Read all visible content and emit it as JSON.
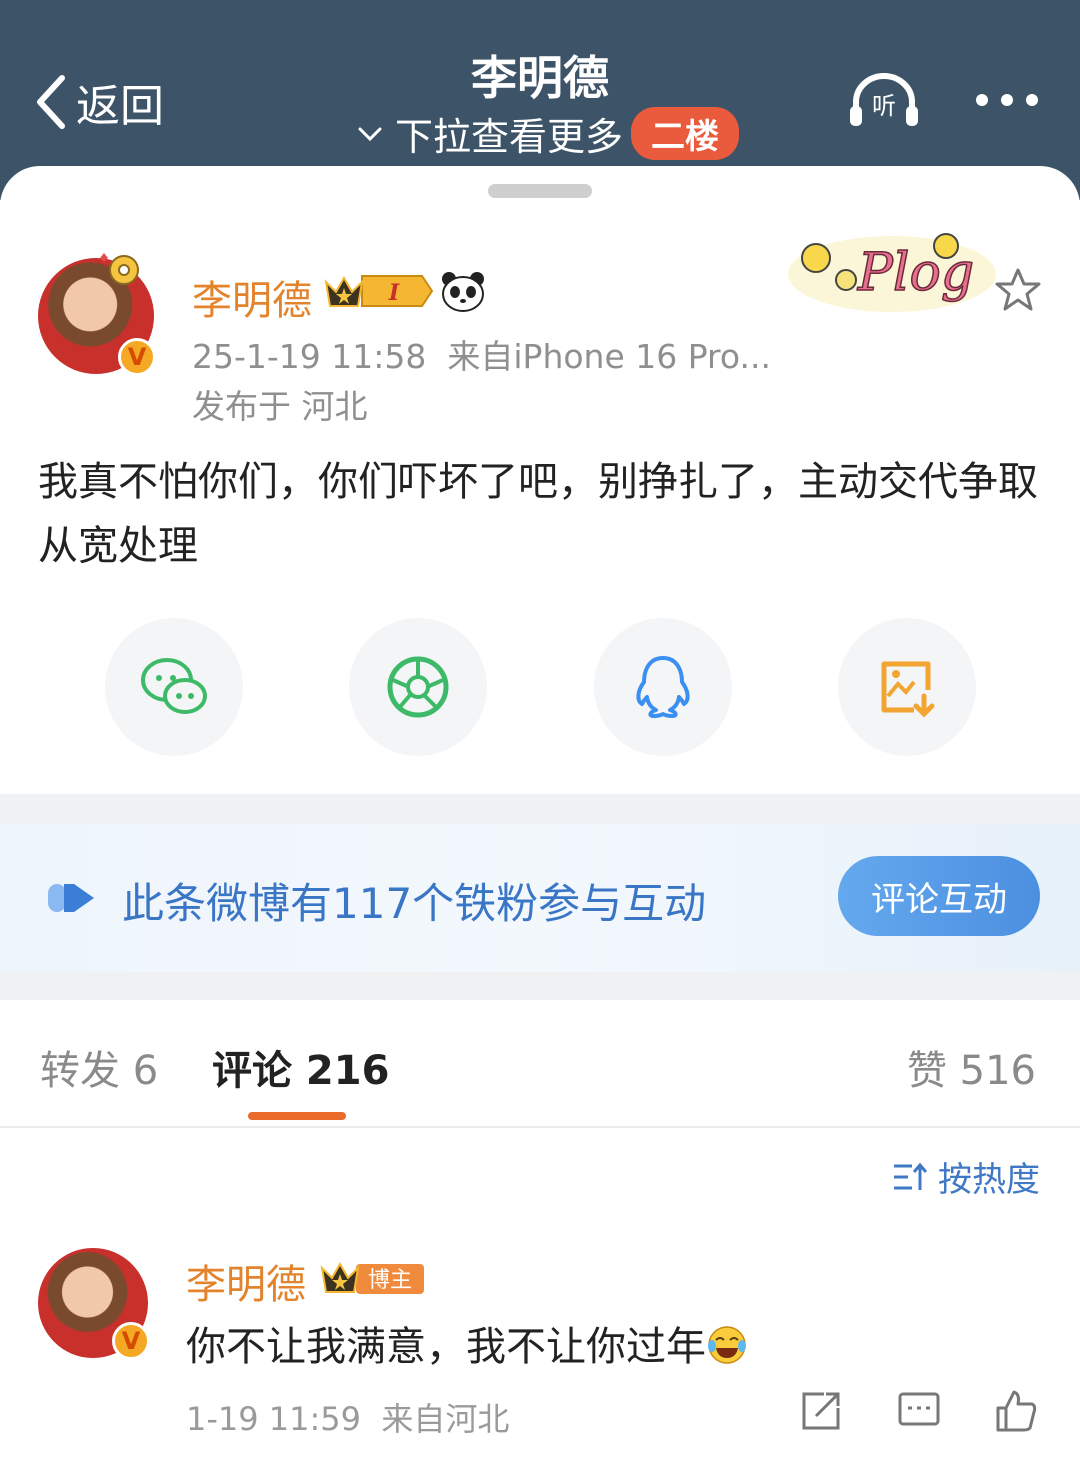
{
  "header": {
    "back_label": "返回",
    "title": "李明德",
    "subtitle": "下拉查看更多",
    "floor_badge": "二楼"
  },
  "post": {
    "author": "李明德",
    "badge_level": "I",
    "timestamp": "25-1-19 11:58",
    "source": "来自iPhone 16 Pro...",
    "location": "发布于 河北",
    "text": "我真不怕你们，你们吓坏了吧，别挣扎了，主动交代争取从宽处理",
    "sticker": "Plog"
  },
  "share": {
    "items": [
      "wechat-icon",
      "moments-icon",
      "qq-icon",
      "save-image-icon"
    ]
  },
  "fans_bar": {
    "text": "此条微博有117个铁粉参与互动",
    "button": "评论互动"
  },
  "tabs": {
    "repost": "转发 6",
    "comments": "评论 216",
    "likes": "赞 516"
  },
  "sort": {
    "label": "按热度"
  },
  "comment": {
    "author": "李明德",
    "badge": "博主",
    "text": "你不让我满意，我不让你过年",
    "emoji": "laughing-tears-icon",
    "time": "1-19 11:59",
    "source": "来自河北"
  },
  "colors": {
    "header_bg": "#3d5468",
    "username": "#e3842d",
    "accent_orange": "#ea6a2a",
    "link_blue": "#3a76c6",
    "badge_red": "#ea5a3c"
  }
}
